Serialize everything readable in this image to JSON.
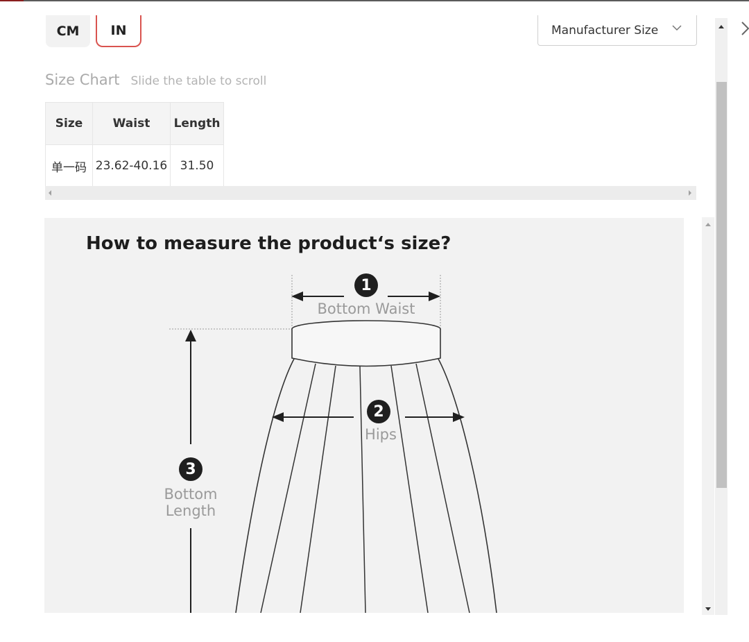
{
  "units": {
    "cm_label": "CM",
    "in_label": "IN",
    "selected": "IN"
  },
  "size_select": {
    "value": "Manufacturer Size"
  },
  "size_chart": {
    "title": "Size Chart",
    "hint": "Slide the table to scroll",
    "columns": [
      "Size",
      "Waist",
      "Length"
    ],
    "rows": [
      [
        "单一码",
        "23.62-40.16",
        "31.50"
      ]
    ]
  },
  "measure": {
    "title": "How to measure the product‘s size?",
    "steps": [
      {
        "number": "1",
        "label": "Bottom Waist"
      },
      {
        "number": "2",
        "label": "Hips"
      },
      {
        "number": "3",
        "label_line1": "Bottom",
        "label_line2": "Length"
      }
    ]
  },
  "colors": {
    "selected_border": "#d9534f",
    "panel_bg": "#f2f2f2"
  },
  "icons": [
    "chevron-down-icon",
    "close-icon",
    "scroll-left-icon",
    "scroll-right-icon",
    "scroll-up-icon",
    "scroll-down-icon"
  ]
}
